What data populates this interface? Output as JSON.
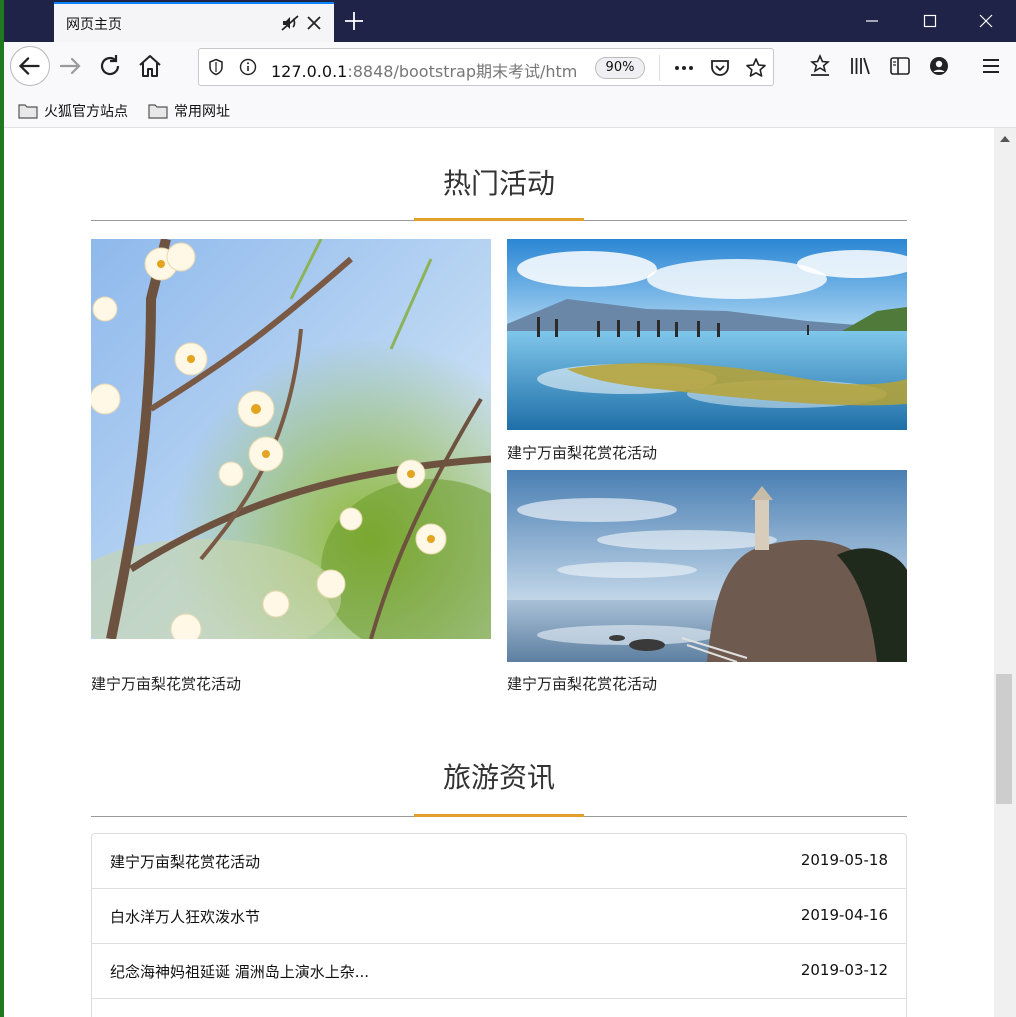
{
  "browser": {
    "tab_title": "网页主页",
    "url_host": "127.0.0.1",
    "url_rest": ":8848/bootstrap期末考试/htm",
    "zoom": "90%",
    "bookmarks": [
      "火狐官方站点",
      "常用网址"
    ]
  },
  "page": {
    "hot_title": "热门活动",
    "hot_items": [
      {
        "caption": "建宁万亩梨花赏花活动",
        "image": "plum-blossom-photo"
      },
      {
        "caption": "建宁万亩梨花赏花活动",
        "image": "lake-reflection-photo"
      },
      {
        "caption": "建宁万亩梨花赏花活动",
        "image": "seaside-rock-pagoda-photo"
      }
    ],
    "news_title": "旅游资讯",
    "news": [
      {
        "title": "建宁万亩梨花赏花活动",
        "date": "2019-05-18"
      },
      {
        "title": "白水洋万人狂欢泼水节",
        "date": "2019-04-16"
      },
      {
        "title": "纪念海神妈祖延诞 湄洲岛上演水上杂...",
        "date": "2019-03-12"
      },
      {
        "title": "",
        "date": ""
      }
    ]
  },
  "colors": {
    "titlebar": "#202348",
    "accent": "#e0a02a",
    "tab_active": "#0a84ff"
  }
}
